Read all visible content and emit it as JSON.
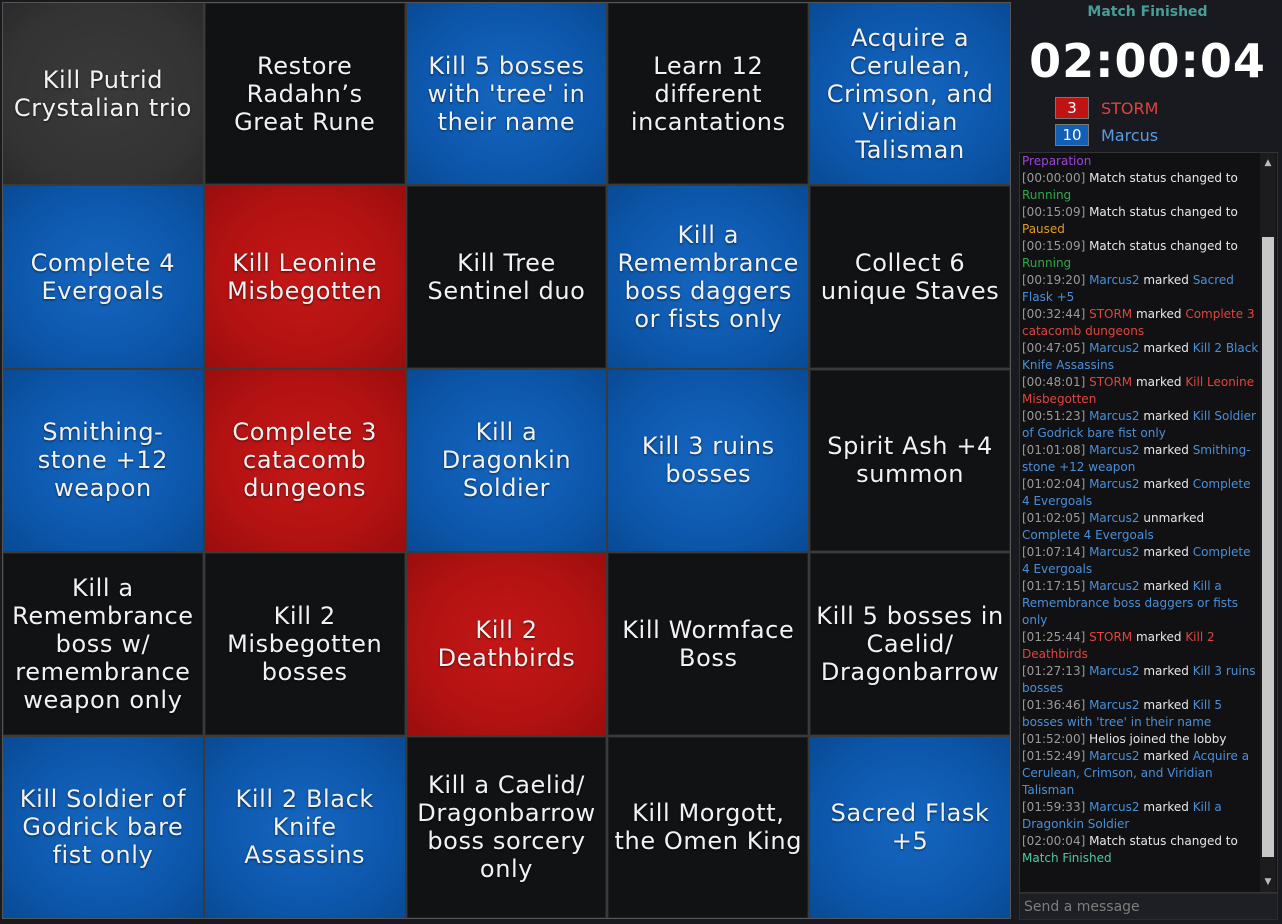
{
  "board": {
    "cells": [
      {
        "text": "Kill Putrid Crystalian trio",
        "color": "gray"
      },
      {
        "text": "Restore Radahn’s Great Rune",
        "color": "none"
      },
      {
        "text": "Kill 5 bosses with 'tree' in their name",
        "color": "blue"
      },
      {
        "text": "Learn 12 different incantations",
        "color": "none"
      },
      {
        "text": "Acquire a Cerulean, Crimson, and Viridian Talisman",
        "color": "blue"
      },
      {
        "text": "Complete 4 Evergoals",
        "color": "blue"
      },
      {
        "text": "Kill Leonine Misbegotten",
        "color": "red"
      },
      {
        "text": "Kill Tree Sentinel duo",
        "color": "none"
      },
      {
        "text": "Kill a Remembrance boss daggers or fists only",
        "color": "blue"
      },
      {
        "text": "Collect 6 unique Staves",
        "color": "none"
      },
      {
        "text": "Smithing-stone +12 weapon",
        "color": "blue"
      },
      {
        "text": "Complete 3 catacomb dungeons",
        "color": "red"
      },
      {
        "text": "Kill a Dragonkin Soldier",
        "color": "blue"
      },
      {
        "text": "Kill 3 ruins bosses",
        "color": "blue"
      },
      {
        "text": "Spirit Ash +4 summon",
        "color": "none"
      },
      {
        "text": "Kill a Remembrance boss w/ remembrance weapon only",
        "color": "none"
      },
      {
        "text": "Kill 2 Misbegotten bosses",
        "color": "none"
      },
      {
        "text": "Kill 2 Deathbirds",
        "color": "red"
      },
      {
        "text": "Kill Wormface Boss",
        "color": "none"
      },
      {
        "text": "Kill 5 bosses in Caelid/ Dragonbarrow",
        "color": "none"
      },
      {
        "text": "Kill Soldier of Godrick bare fist only",
        "color": "blue"
      },
      {
        "text": "Kill 2 Black Knife Assassins",
        "color": "blue"
      },
      {
        "text": "Kill a Caelid/ Dragonbarrow boss sorcery only",
        "color": "none"
      },
      {
        "text": "Kill Morgott, the Omen King",
        "color": "none"
      },
      {
        "text": "Sacred Flask +5",
        "color": "blue"
      }
    ]
  },
  "match": {
    "status": "Match Finished",
    "timer": "02:00:04"
  },
  "players": [
    {
      "score": "3",
      "name": "STORM",
      "color": "#c01414"
    },
    {
      "score": "10",
      "name": "Marcus",
      "color": "#1160b6"
    }
  ],
  "log": [
    {
      "parts": [
        {
          "t": "Preparation",
          "c": "purple"
        }
      ]
    },
    {
      "parts": [
        {
          "t": "[00:00:00] ",
          "c": "ts"
        },
        {
          "t": "Match status changed to ",
          "c": ""
        },
        {
          "t": "Running",
          "c": "green"
        }
      ]
    },
    {
      "parts": [
        {
          "t": "[00:15:09] ",
          "c": "ts"
        },
        {
          "t": "Match status changed to ",
          "c": ""
        },
        {
          "t": "Paused",
          "c": "orange"
        }
      ]
    },
    {
      "parts": [
        {
          "t": "[00:15:09] ",
          "c": "ts"
        },
        {
          "t": "Match status changed to ",
          "c": ""
        },
        {
          "t": "Running",
          "c": "green"
        }
      ]
    },
    {
      "parts": [
        {
          "t": "[00:19:20] ",
          "c": "ts"
        },
        {
          "t": "Marcus2",
          "c": "blue"
        },
        {
          "t": " marked ",
          "c": ""
        },
        {
          "t": "Sacred Flask +5",
          "c": "blue"
        }
      ]
    },
    {
      "parts": [
        {
          "t": "[00:32:44] ",
          "c": "ts"
        },
        {
          "t": "STORM",
          "c": "red"
        },
        {
          "t": " marked ",
          "c": ""
        },
        {
          "t": "Complete 3 catacomb dungeons",
          "c": "red"
        }
      ]
    },
    {
      "parts": [
        {
          "t": "[00:47:05] ",
          "c": "ts"
        },
        {
          "t": "Marcus2",
          "c": "blue"
        },
        {
          "t": " marked ",
          "c": ""
        },
        {
          "t": "Kill 2 Black Knife Assassins",
          "c": "blue"
        }
      ]
    },
    {
      "parts": [
        {
          "t": "[00:48:01] ",
          "c": "ts"
        },
        {
          "t": "STORM",
          "c": "red"
        },
        {
          "t": " marked ",
          "c": ""
        },
        {
          "t": "Kill Leonine Misbegotten",
          "c": "red"
        }
      ]
    },
    {
      "parts": [
        {
          "t": "[00:51:23] ",
          "c": "ts"
        },
        {
          "t": "Marcus2",
          "c": "blue"
        },
        {
          "t": " marked ",
          "c": ""
        },
        {
          "t": "Kill Soldier of Godrick bare fist only",
          "c": "blue"
        }
      ]
    },
    {
      "parts": [
        {
          "t": "[01:01:08] ",
          "c": "ts"
        },
        {
          "t": "Marcus2",
          "c": "blue"
        },
        {
          "t": " marked ",
          "c": ""
        },
        {
          "t": "Smithing-stone +12 weapon",
          "c": "blue"
        }
      ]
    },
    {
      "parts": [
        {
          "t": "[01:02:04] ",
          "c": "ts"
        },
        {
          "t": "Marcus2",
          "c": "blue"
        },
        {
          "t": " marked ",
          "c": ""
        },
        {
          "t": "Complete 4 Evergoals",
          "c": "blue"
        }
      ]
    },
    {
      "parts": [
        {
          "t": "[01:02:05] ",
          "c": "ts"
        },
        {
          "t": "Marcus2",
          "c": "blue"
        },
        {
          "t": " unmarked ",
          "c": ""
        },
        {
          "t": "Complete 4 Evergoals",
          "c": "blue"
        }
      ]
    },
    {
      "parts": [
        {
          "t": "[01:07:14] ",
          "c": "ts"
        },
        {
          "t": "Marcus2",
          "c": "blue"
        },
        {
          "t": " marked ",
          "c": ""
        },
        {
          "t": "Complete 4 Evergoals",
          "c": "blue"
        }
      ]
    },
    {
      "parts": [
        {
          "t": "[01:17:15] ",
          "c": "ts"
        },
        {
          "t": "Marcus2",
          "c": "blue"
        },
        {
          "t": " marked ",
          "c": ""
        },
        {
          "t": "Kill a Remembrance boss daggers or fists only",
          "c": "blue"
        }
      ]
    },
    {
      "parts": [
        {
          "t": "[01:25:44] ",
          "c": "ts"
        },
        {
          "t": "STORM",
          "c": "red"
        },
        {
          "t": " marked ",
          "c": ""
        },
        {
          "t": "Kill 2 Deathbirds",
          "c": "red"
        }
      ]
    },
    {
      "parts": [
        {
          "t": "[01:27:13] ",
          "c": "ts"
        },
        {
          "t": "Marcus2",
          "c": "blue"
        },
        {
          "t": " marked ",
          "c": ""
        },
        {
          "t": "Kill 3 ruins bosses",
          "c": "blue"
        }
      ]
    },
    {
      "parts": [
        {
          "t": "[01:36:46] ",
          "c": "ts"
        },
        {
          "t": "Marcus2",
          "c": "blue"
        },
        {
          "t": " marked ",
          "c": ""
        },
        {
          "t": "Kill 5 bosses with 'tree' in their name",
          "c": "blue"
        }
      ]
    },
    {
      "parts": [
        {
          "t": "[01:52:00] ",
          "c": "ts"
        },
        {
          "t": "Helios joined the lobby",
          "c": ""
        }
      ]
    },
    {
      "parts": [
        {
          "t": "[01:52:49] ",
          "c": "ts"
        },
        {
          "t": "Marcus2",
          "c": "blue"
        },
        {
          "t": " marked ",
          "c": ""
        },
        {
          "t": "Acquire a Cerulean, Crimson, and Viridian Talisman",
          "c": "blue"
        }
      ]
    },
    {
      "parts": [
        {
          "t": "[01:59:33] ",
          "c": "ts"
        },
        {
          "t": "Marcus2",
          "c": "blue"
        },
        {
          "t": " marked ",
          "c": ""
        },
        {
          "t": "Kill a Dragonkin Soldier",
          "c": "blue"
        }
      ]
    },
    {
      "parts": [
        {
          "t": "[02:00:04] ",
          "c": "ts"
        },
        {
          "t": "Match status changed to ",
          "c": ""
        },
        {
          "t": "Match Finished",
          "c": "teal"
        }
      ]
    }
  ],
  "chat": {
    "placeholder": "Send a message"
  },
  "icons": {
    "scroll_up": "scroll-up-arrow-icon",
    "scroll_down": "scroll-down-arrow-icon"
  }
}
